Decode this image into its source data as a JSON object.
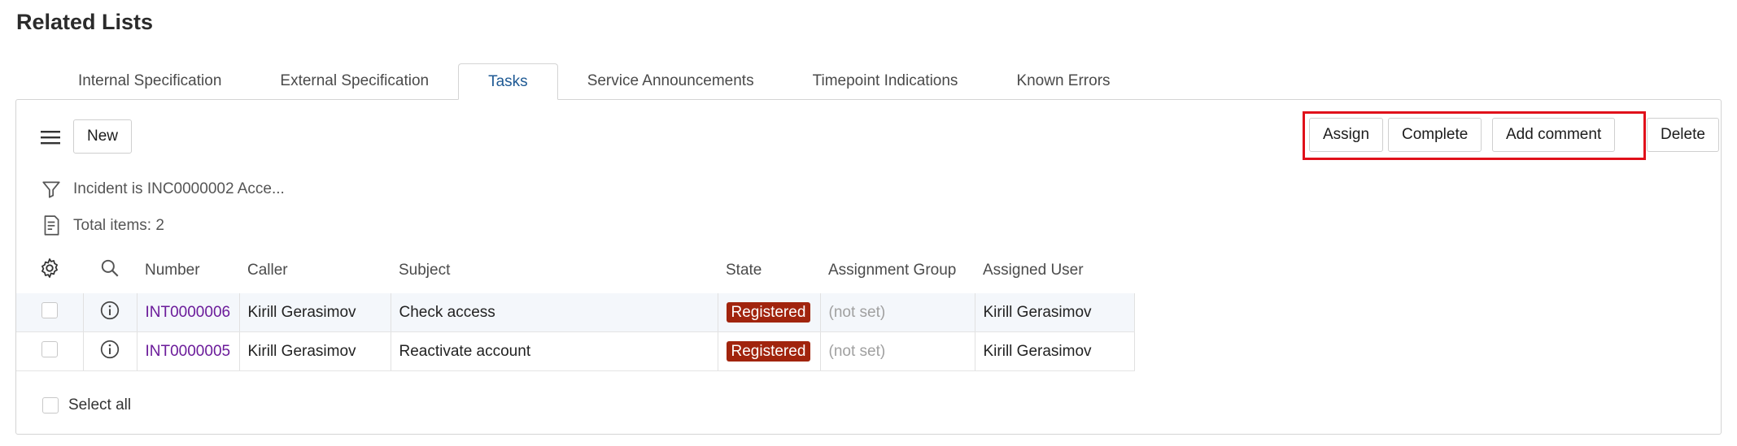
{
  "page": {
    "title": "Related Lists"
  },
  "tabs": [
    {
      "label": "Internal Specification"
    },
    {
      "label": "External Specification"
    },
    {
      "label": "Tasks"
    },
    {
      "label": "Service Announcements"
    },
    {
      "label": "Timepoint Indications"
    },
    {
      "label": "Known Errors"
    }
  ],
  "active_tab": "Tasks",
  "toolbar": {
    "new_label": "New",
    "assign_label": "Assign",
    "complete_label": "Complete",
    "add_comment_label": "Add comment",
    "delete_label": "Delete"
  },
  "filter": {
    "text": "Incident is INC0000002 Acce..."
  },
  "total": {
    "text": "Total items: 2"
  },
  "table": {
    "columns": {
      "number": "Number",
      "caller": "Caller",
      "subject": "Subject",
      "state": "State",
      "assignment_group": "Assignment Group",
      "assigned_user": "Assigned User"
    },
    "rows": [
      {
        "number": "INT0000006",
        "caller": "Kirill Gerasimov",
        "subject": "Check access",
        "state": "Registered",
        "assignment_group": "(not set)",
        "assigned_user": "Kirill Gerasimov"
      },
      {
        "number": "INT0000005",
        "caller": "Kirill Gerasimov",
        "subject": "Reactivate account",
        "state": "Registered",
        "assignment_group": "(not set)",
        "assigned_user": "Kirill Gerasimov"
      }
    ]
  },
  "select_all": {
    "label": "Select all"
  },
  "colors": {
    "active_tab": "#1f5a94",
    "link": "#6b1b9a",
    "state_badge": "#a1240d",
    "highlight_box": "#e0101a",
    "row_highlight": "#f4f7fb"
  },
  "icons": [
    "menu-icon",
    "filter-icon",
    "list-count-icon",
    "gear-icon",
    "search-icon",
    "info-icon"
  ]
}
